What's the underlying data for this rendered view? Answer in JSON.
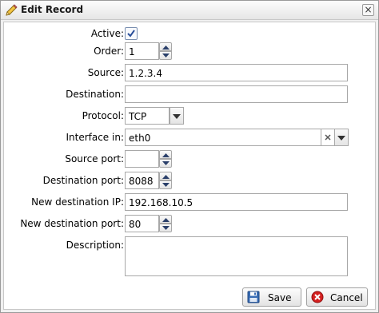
{
  "window": {
    "title": "Edit Record",
    "close_glyph": "×"
  },
  "form": {
    "active_label": "Active:",
    "active_checked": true,
    "order_label": "Order:",
    "order_value": "1",
    "source_label": "Source:",
    "source_value": "1.2.3.4",
    "destination_label": "Destination:",
    "destination_value": "",
    "protocol_label": "Protocol:",
    "protocol_value": "TCP",
    "interface_label": "Interface in:",
    "interface_value": "eth0",
    "source_port_label": "Source port:",
    "source_port_value": "",
    "destination_port_label": "Destination port:",
    "destination_port_value": "8088",
    "new_destination_ip_label": "New destination IP:",
    "new_destination_ip_value": "192.168.10.5",
    "new_destination_port_label": "New destination port:",
    "new_destination_port_value": "80",
    "description_label": "Description:",
    "description_value": ""
  },
  "buttons": {
    "save_label": "Save",
    "cancel_label": "Cancel"
  },
  "colors": {
    "cancel_icon": "#d42020",
    "save_icon": "#3a6db5",
    "check": "#2a4f9a"
  }
}
